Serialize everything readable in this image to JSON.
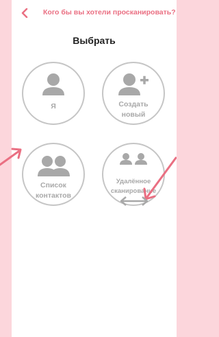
{
  "header": {
    "title": "Кого бы вы хотели просканировать?",
    "back_icon": "chevron-left-icon"
  },
  "subtitle": "Выбрать",
  "options": [
    {
      "icon": "person-icon",
      "lines": [
        "Я"
      ]
    },
    {
      "icon": "person-add-icon",
      "lines": [
        "Создать",
        "новый"
      ]
    },
    {
      "icon": "contacts-group-icon",
      "lines": [
        "Список",
        "контактов"
      ]
    },
    {
      "icon": "remote-scan-icon",
      "lines": [
        "Удалённое",
        "сканирование"
      ]
    }
  ],
  "colors": {
    "accent": "#ea6f82",
    "background": "#fcd6dc",
    "icon_grey": "#a8a8a8",
    "circle_border": "#c5c5c5"
  }
}
